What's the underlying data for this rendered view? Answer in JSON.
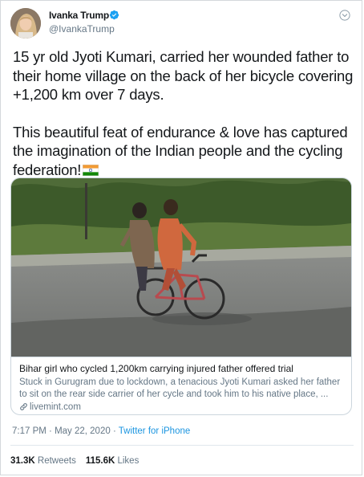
{
  "user": {
    "name": "Ivanka Trump",
    "handle": "@IvankaTrump"
  },
  "tweet": {
    "paragraph1": "15 yr old Jyoti Kumari, carried her wounded father to their home village on the back of her bicycle covering +1,200 km over 7 days.",
    "paragraph2": "This beautiful feat of endurance & love has captured the imagination of the Indian people and the cycling federation!"
  },
  "card": {
    "title": "Bihar girl who cycled 1,200km carrying injured father offered trial",
    "description": "Stuck in Gurugram due to lockdown, a tenacious Jyoti Kumari asked her father to sit on the rear side carrier of her cycle and took him to his native place, ...",
    "domain": "livemint.com"
  },
  "meta": {
    "time": "7:17 PM",
    "separator": " · ",
    "date": "May 22, 2020",
    "source": "Twitter for iPhone"
  },
  "stats": {
    "retweets_count": "31.3K",
    "retweets_label": "Retweets",
    "likes_count": "115.6K",
    "likes_label": "Likes"
  },
  "colors": {
    "accent": "#1b95e0",
    "secondary_text": "#657786"
  },
  "icons": [
    "verified-badge-icon",
    "chevron-down-icon",
    "link-icon",
    "india-flag-emoji"
  ]
}
